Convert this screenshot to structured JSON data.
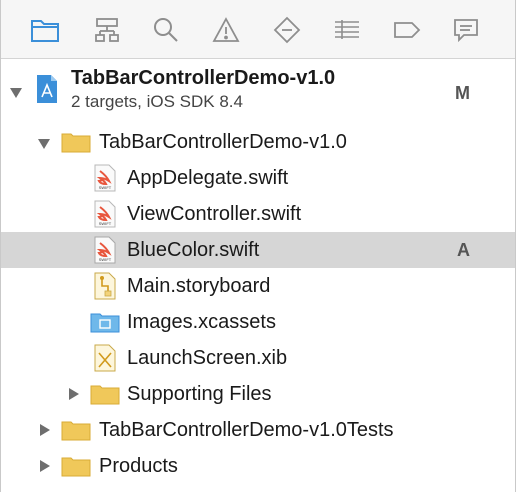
{
  "toolbar": {
    "icons": [
      "folder-icon",
      "hierarchy-icon",
      "search-icon",
      "warning-icon",
      "test-diamond-icon",
      "list-lines-icon",
      "tag-icon",
      "comment-icon"
    ]
  },
  "project": {
    "name": "TabBarControllerDemo-v1.0",
    "subtitle": "2 targets, iOS SDK 8.4",
    "badge": "M"
  },
  "tree": {
    "group_main": "TabBarControllerDemo-v1.0",
    "files": [
      {
        "name": "AppDelegate.swift",
        "badge": ""
      },
      {
        "name": "ViewController.swift",
        "badge": ""
      },
      {
        "name": "BlueColor.swift",
        "badge": "A"
      },
      {
        "name": "Main.storyboard",
        "badge": ""
      },
      {
        "name": "Images.xcassets",
        "badge": ""
      },
      {
        "name": "LaunchScreen.xib",
        "badge": ""
      }
    ],
    "supporting": "Supporting Files",
    "tests": "TabBarControllerDemo-v1.0Tests",
    "products": "Products"
  },
  "colors": {
    "accent": "#3b8fd9",
    "folder": "#f0c85a",
    "swift": "#e8563d",
    "selection": "#d6d6d6"
  },
  "swift_icon_text": "SWIFT"
}
